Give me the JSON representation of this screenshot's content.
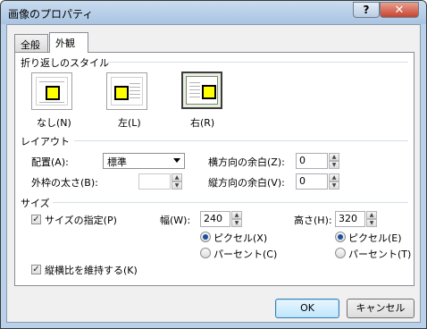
{
  "window": {
    "title": "画像のプロパティ",
    "help": "?",
    "close": "✕"
  },
  "tabs": [
    "全般",
    "外観"
  ],
  "wrap": {
    "title": "折り返しのスタイル",
    "options": [
      "なし(N)",
      "左(L)",
      "右(R)"
    ],
    "selected": "右(R)"
  },
  "layout": {
    "title": "レイアウト",
    "align_label": "配置(A):",
    "align_value": "標準",
    "border_label": "外枠の太さ(B):",
    "border_value": "",
    "hmargin_label": "横方向の余白(Z):",
    "hmargin_value": "0",
    "vmargin_label": "縦方向の余白(V):",
    "vmargin_value": "0"
  },
  "size": {
    "title": "サイズ",
    "specify_label": "サイズの指定(P)",
    "specify_checked": true,
    "width_label": "幅(W):",
    "width_value": "240",
    "height_label": "高さ(H):",
    "height_value": "320",
    "w_pixel": "ピクセル(X)",
    "w_percent": "パーセント(C)",
    "h_pixel": "ピクセル(E)",
    "h_percent": "パーセント(T)",
    "aspect_label": "縦横比を維持する(K)",
    "aspect_checked": true,
    "check_mark": "✓"
  },
  "buttons": {
    "ok": "OK",
    "cancel": "キャンセル"
  },
  "spin_glyphs": {
    "up": "▲",
    "down": "▼"
  }
}
